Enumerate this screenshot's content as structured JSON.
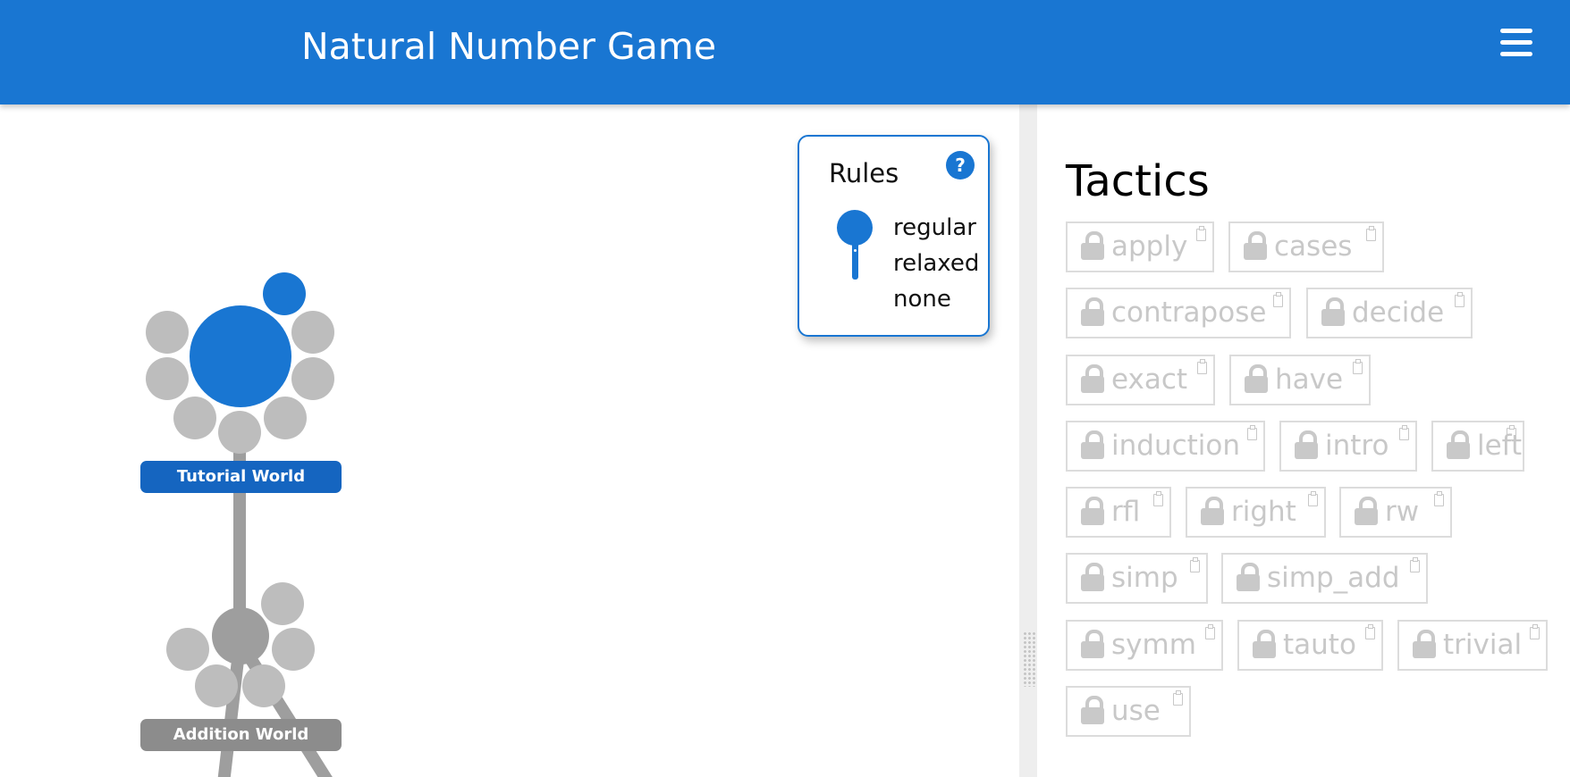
{
  "header": {
    "title": "Natural Number Game"
  },
  "world_map": {
    "worlds": [
      {
        "label": "Tutorial World",
        "color": "#1565c0",
        "status": "unlocked"
      },
      {
        "label": "Addition World",
        "color": "#8c8c8c",
        "status": "locked"
      }
    ]
  },
  "rules": {
    "title": "Rules",
    "help_label": "?",
    "options": [
      "regular",
      "relaxed",
      "none"
    ],
    "selected": "regular"
  },
  "tactics": {
    "title": "Tactics",
    "items": [
      "apply",
      "cases",
      "contrapose",
      "decide",
      "exact",
      "have",
      "induction",
      "intro",
      "left",
      "rfl",
      "right",
      "rw",
      "simp",
      "simp_add",
      "symm",
      "tauto",
      "trivial",
      "use"
    ]
  },
  "colors": {
    "primary": "#1976d2",
    "locked_node": "#bdbdbd",
    "locked_text": "#c8c8c8"
  }
}
